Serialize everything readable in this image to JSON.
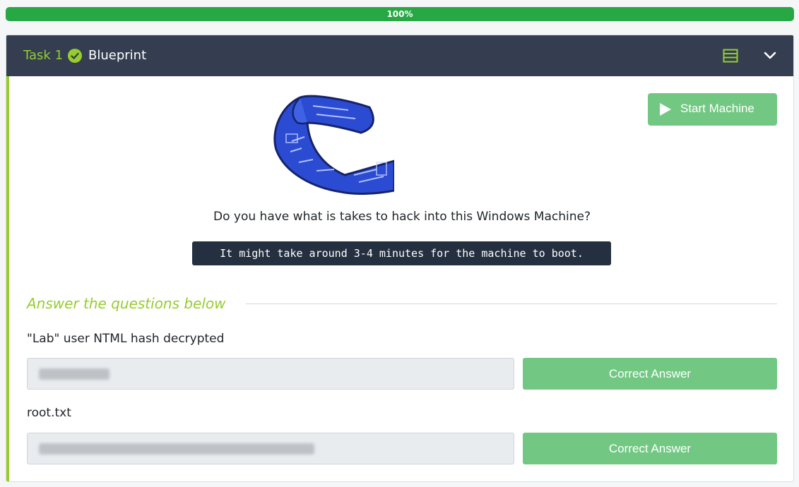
{
  "progress": {
    "label": "100%",
    "percent": 100
  },
  "task": {
    "number_label": "Task 1",
    "title": "Blueprint",
    "start_button_label": "Start Machine",
    "description": "Do you have what is takes to hack into this Windows Machine?",
    "code_note": "It might take around 3-4 minutes for the machine to boot.",
    "answer_heading": "Answer the questions below",
    "questions": [
      {
        "label": "\"Lab\" user NTML hash decrypted",
        "answer_value": "",
        "button_label": "Correct Answer"
      },
      {
        "label": "root.txt",
        "answer_value": "",
        "button_label": "Correct Answer"
      }
    ]
  },
  "colors": {
    "header_bg": "#343e50",
    "accent_green": "#96cd2d",
    "success_green": "#27a844",
    "button_green": "#72c883",
    "code_bg": "#243040"
  },
  "icons": [
    "check-circle-icon",
    "list-icon",
    "chevron-down-icon",
    "play-icon",
    "blueprint-scroll-image"
  ]
}
